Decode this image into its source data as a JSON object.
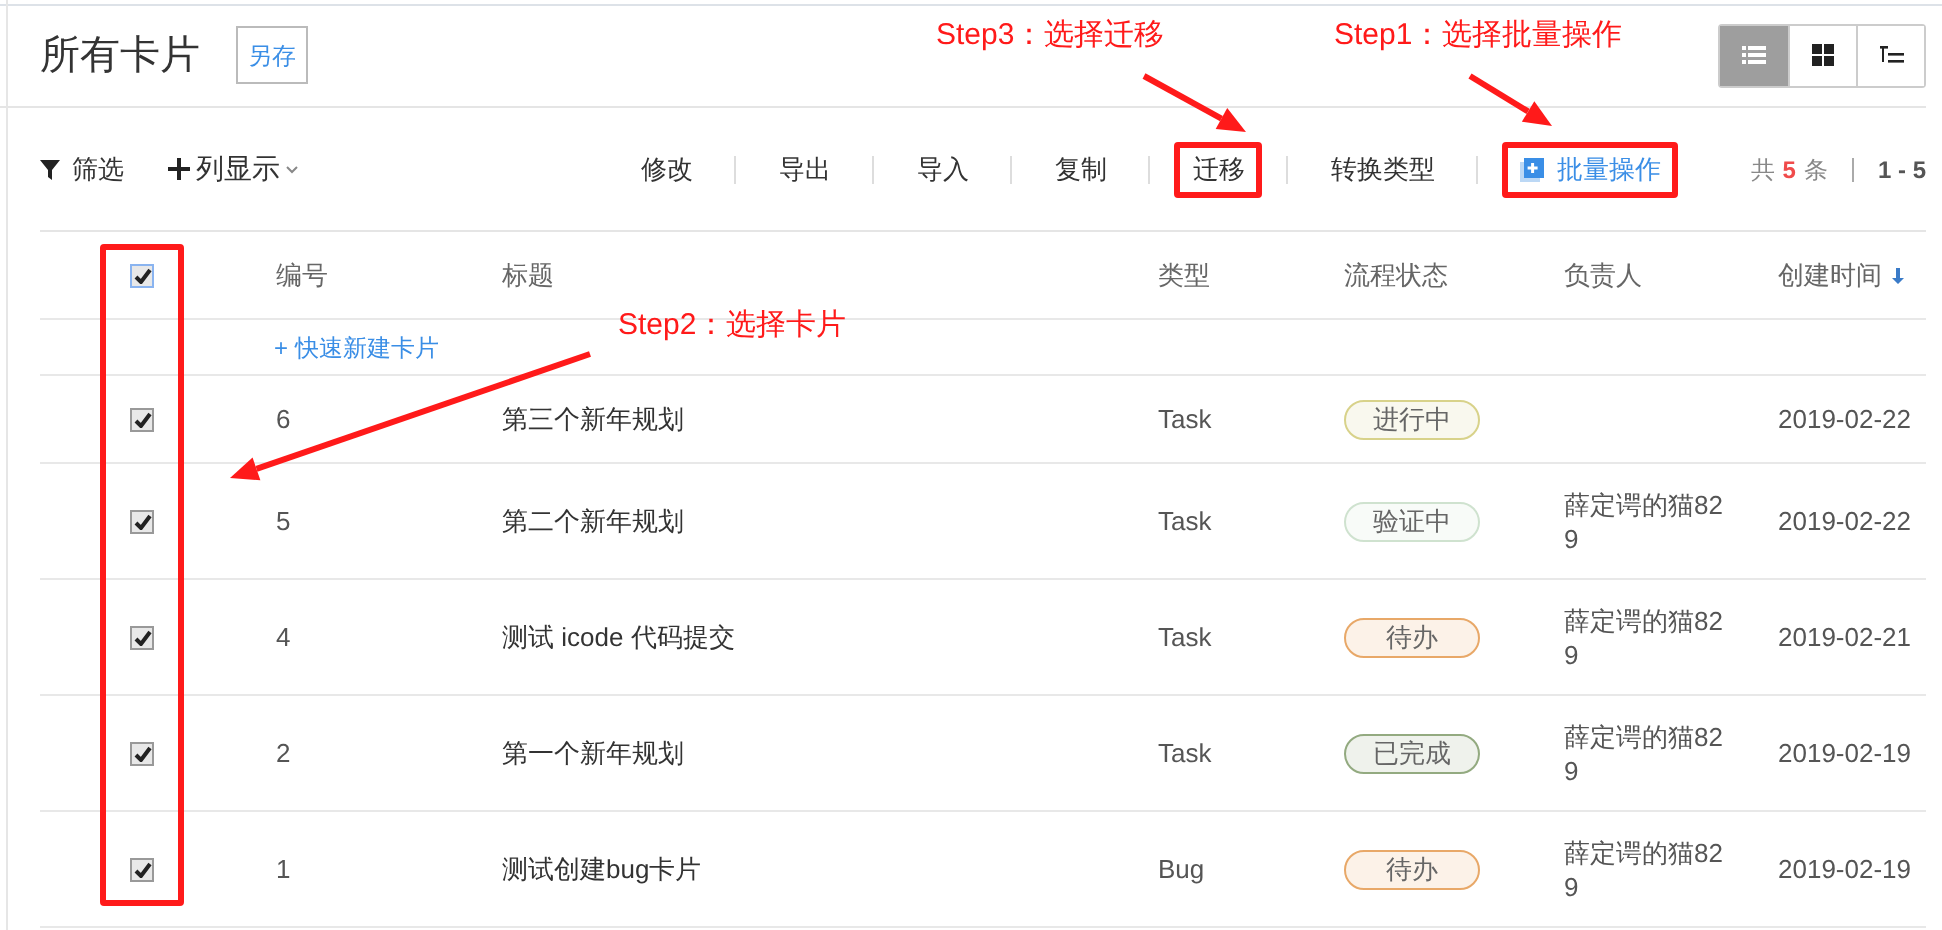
{
  "header": {
    "title": "所有卡片",
    "save_as": "另存",
    "views": [
      {
        "kind": "list",
        "selected": true
      },
      {
        "kind": "grid",
        "selected": false
      },
      {
        "kind": "tree",
        "selected": false
      }
    ]
  },
  "toolbar": {
    "filter": "筛选",
    "columns": "列显示",
    "actions": [
      {
        "label": "修改",
        "highlighted": false
      },
      {
        "label": "导出",
        "highlighted": false
      },
      {
        "label": "导入",
        "highlighted": false
      },
      {
        "label": "复制",
        "highlighted": false
      },
      {
        "label": "迁移",
        "highlighted": true
      },
      {
        "label": "转换类型",
        "highlighted": false
      },
      {
        "label": "批量操作",
        "highlighted": true,
        "kind": "batch"
      }
    ],
    "total_prefix": "共",
    "total": "5",
    "total_suffix": "条",
    "range": "1 - 5"
  },
  "table": {
    "select_all_checked": true,
    "checkbox_column_highlighted": true,
    "columns": [
      {
        "label": "编号",
        "sorted": false
      },
      {
        "label": "标题",
        "sorted": false
      },
      {
        "label": "类型",
        "sorted": false
      },
      {
        "label": "流程状态",
        "sorted": false
      },
      {
        "label": "负责人",
        "sorted": false
      },
      {
        "label": "创建时间",
        "sorted": true
      }
    ],
    "quick_create": "+ 快速新建卡片",
    "rows": [
      {
        "checked": true,
        "id": "6",
        "title": "第三个新年规划",
        "type": "Task",
        "status": {
          "label": "进行中",
          "color": "#d8d28a"
        },
        "assignee": "",
        "created": "2019-02-22"
      },
      {
        "checked": true,
        "id": "5",
        "title": "第二个新年规划",
        "type": "Task",
        "status": {
          "label": "验证中",
          "color": "#cfe2cf"
        },
        "assignee": "薛定谔的猫829",
        "created": "2019-02-22"
      },
      {
        "checked": true,
        "id": "4",
        "title": "测试 icode 代码提交",
        "type": "Task",
        "status": {
          "label": "待办",
          "color": "#e8a868"
        },
        "assignee": "薛定谔的猫829",
        "created": "2019-02-21"
      },
      {
        "checked": true,
        "id": "2",
        "title": "第一个新年规划",
        "type": "Task",
        "status": {
          "label": "已完成",
          "color": "#93aa80"
        },
        "assignee": "薛定谔的猫829",
        "created": "2019-02-19"
      },
      {
        "checked": true,
        "id": "1",
        "title": "测试创建bug卡片",
        "type": "Bug",
        "status": {
          "label": "待办",
          "color": "#e8a868"
        },
        "assignee": "薛定谔的猫829",
        "created": "2019-02-19"
      }
    ]
  },
  "annotations": [
    {
      "text": "Step3：选择迁移"
    },
    {
      "text": "Step1：选择批量操作"
    },
    {
      "text": "Step2：选择卡片"
    }
  ]
}
